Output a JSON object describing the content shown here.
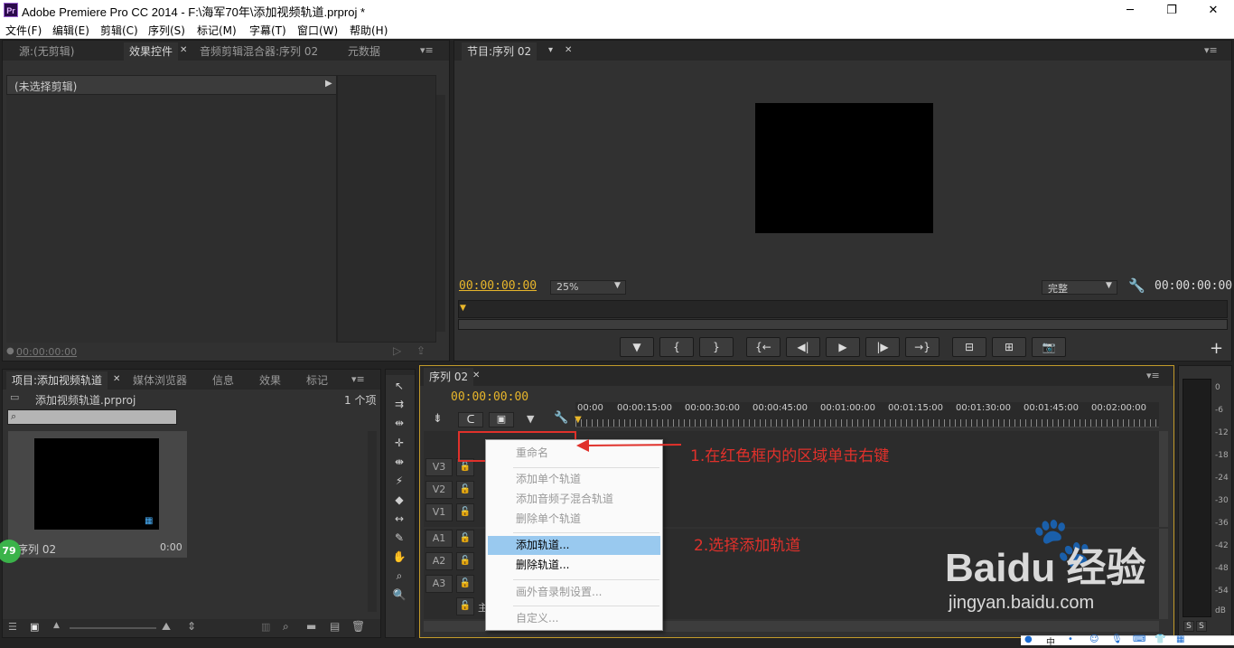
{
  "window": {
    "app_icon": "Pr",
    "title": "Adobe Premiere Pro CC 2014 - F:\\海军70年\\添加视频轨道.prproj *",
    "minimize": "─",
    "maximize": "❐",
    "close": "✕"
  },
  "menu": [
    "文件(F)",
    "编辑(E)",
    "剪辑(C)",
    "序列(S)",
    "标记(M)",
    "字幕(T)",
    "窗口(W)",
    "帮助(H)"
  ],
  "source_panel": {
    "tabs": [
      "源:(无剪辑)",
      "效果控件",
      "音频剪辑混合器:序列 02",
      "元数据"
    ],
    "no_clip": "(未选择剪辑)",
    "timecode": "00:00:00:00"
  },
  "program_monitor": {
    "tab": "节目:序列 02",
    "timecode_left": "00:00:00:00",
    "zoom": "25%",
    "quality": "完整",
    "timecode_right": "00:00:00:00",
    "buttons": [
      "▼",
      "{",
      "}",
      "{←",
      "◀|",
      "▶",
      "|▶",
      "→}",
      "⊟",
      "⊞",
      "📷"
    ],
    "add": "+"
  },
  "project_panel": {
    "tabs": [
      "项目:添加视频轨道",
      "媒体浏览器",
      "信息",
      "效果",
      "标记"
    ],
    "file": "添加视频轨道.prproj",
    "count": "1 个项",
    "search_placeholder": "",
    "item_name": "序列 02",
    "item_duration": "0:00",
    "badge": "79"
  },
  "timeline": {
    "tab": "序列 02",
    "timecode": "00:00:00:00",
    "ruler": [
      "00:00",
      "00:00:15:00",
      "00:00:30:00",
      "00:00:45:00",
      "00:01:00:00",
      "00:01:15:00",
      "00:01:30:00",
      "00:01:45:00",
      "00:02:00:00"
    ],
    "video_tracks": [
      "V3",
      "V2",
      "V1"
    ],
    "audio_tracks": [
      "A1",
      "A2",
      "A3"
    ],
    "master_label": "主"
  },
  "context_menu": {
    "items": [
      {
        "label": "重命名",
        "enabled": false
      },
      {
        "label": "添加单个轨道",
        "enabled": false
      },
      {
        "label": "添加音频子混合轨道",
        "enabled": false
      },
      {
        "label": "删除单个轨道",
        "enabled": false
      },
      {
        "label": "添加轨道...",
        "enabled": true,
        "highlighted": true
      },
      {
        "label": "删除轨道...",
        "enabled": true
      },
      {
        "label": "画外音录制设置...",
        "enabled": false
      },
      {
        "label": "自定义...",
        "enabled": false
      }
    ]
  },
  "annotations": {
    "step1": "1.在红色框内的区域单击右键",
    "step2": "2.选择添加轨道",
    "color": "#e0312b"
  },
  "meter": {
    "scale": [
      "0",
      "-6",
      "-12",
      "-18",
      "-24",
      "-30",
      "-36",
      "-42",
      "-48",
      "-54",
      "dB"
    ],
    "solo": [
      "S",
      "S"
    ]
  },
  "watermark": {
    "logo": "Baidu 经验",
    "url": "jingyan.baidu.com"
  },
  "taskbar": {
    "ime": "中"
  }
}
